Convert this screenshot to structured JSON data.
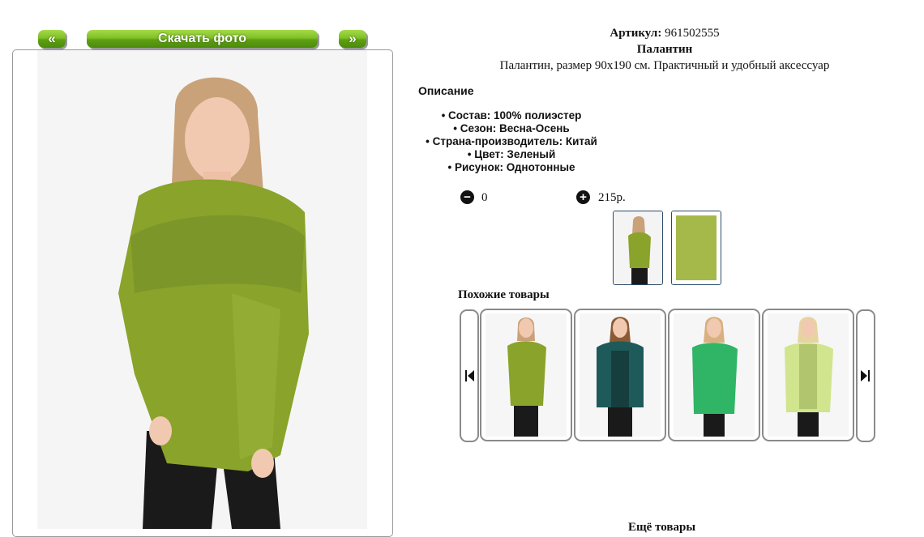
{
  "nav": {
    "prev_label": "«",
    "download_label": "Скачать фото",
    "next_label": "»"
  },
  "product": {
    "article_label": "Артикул:",
    "article_value": "961502555",
    "name": "Палантин",
    "short_description": "Палантин, размер 90х190 см. Практичный и удобный аксессуар",
    "description_heading": "Описание",
    "specs": [
      "Состав: 100% полиэстер",
      "Сезон: Весна-Осень",
      "Страна-производитель: Китай",
      "Цвет: Зеленый",
      "Рисунок: Однотонные"
    ],
    "quantity": "0",
    "price": "215р.",
    "scarf_color": "#8aa32a"
  },
  "similar": {
    "title": "Похожие товары",
    "items": [
      {
        "color": "#8aa32a"
      },
      {
        "color": "#1f5a5a"
      },
      {
        "color": "#2fb565"
      },
      {
        "color": "#c9e27a"
      }
    ]
  },
  "more": {
    "title": "Ещё товары"
  }
}
